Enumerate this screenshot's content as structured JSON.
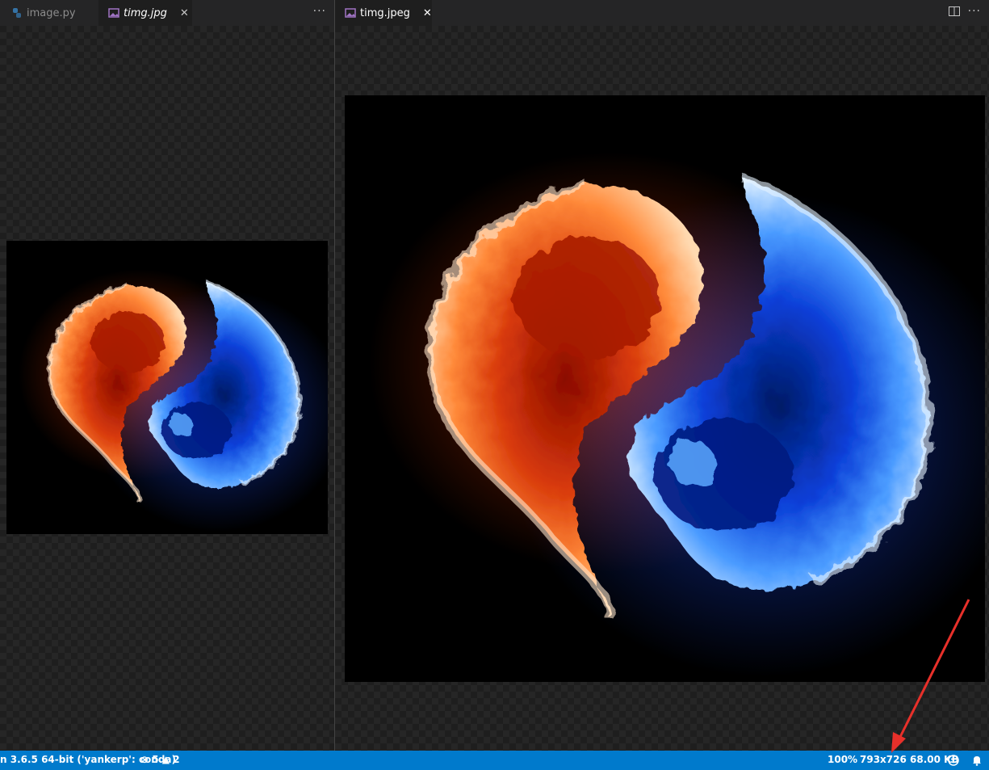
{
  "left_group": {
    "tabs": [
      {
        "label": "image.py",
        "icon": "python-file-icon",
        "italic": false,
        "active": false
      },
      {
        "label": "timg.jpg",
        "icon": "image-file-icon",
        "italic": true,
        "active": true
      }
    ],
    "close_glyph": "✕",
    "more_glyph": "···"
  },
  "right_group": {
    "tabs": [
      {
        "label": "timg.jpeg",
        "icon": "image-file-icon",
        "italic": false,
        "active": true
      }
    ],
    "close_glyph": "✕",
    "more_glyph": "···"
  },
  "image_subject": "yin-yang of fire and blue flames",
  "statusbar": {
    "interpreter": "n 3.6.5 64-bit ('yankerp': conda)",
    "errors": "5",
    "warnings": "2",
    "zoom": "100%",
    "image_info": "793x726 68.00 KB",
    "feedback_icon": "smiley-icon",
    "bell_icon": "bell-icon"
  },
  "colors": {
    "statusbar_bg": "#007acc",
    "annotation_arrow": "#e8302a",
    "fire": "#ff6a1a",
    "ice": "#2a7bff"
  }
}
